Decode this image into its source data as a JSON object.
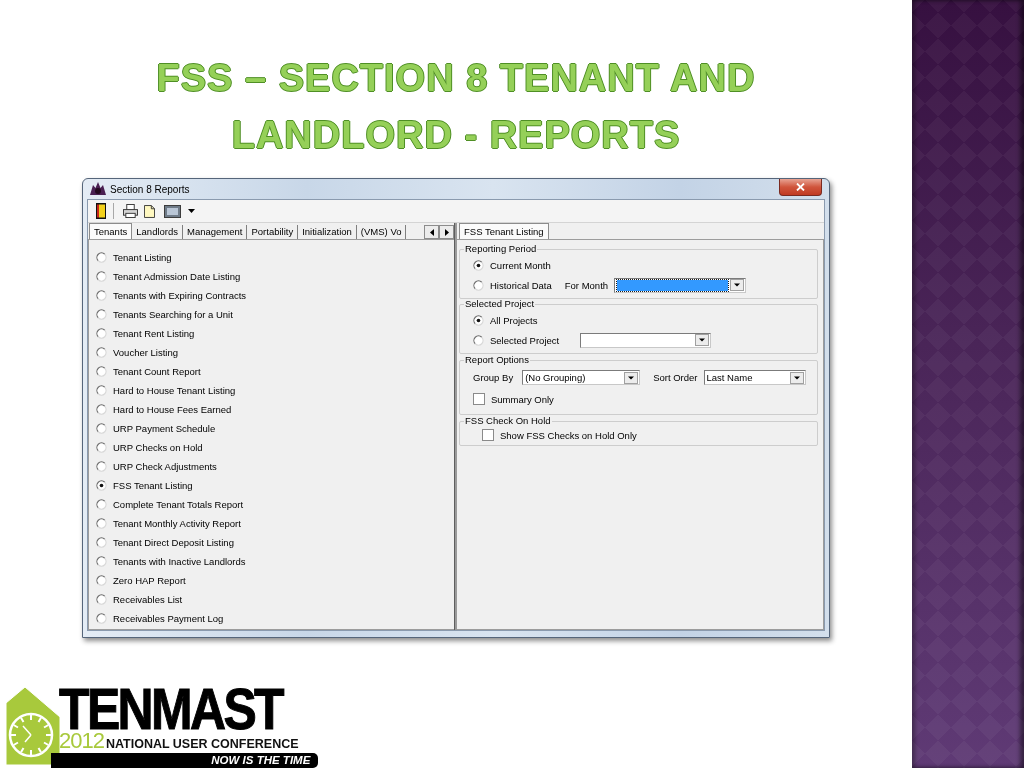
{
  "slide": {
    "title": "FSS – SECTION 8 TENANT AND LANDLORD - REPORTS"
  },
  "window": {
    "title": "Section 8 Reports"
  },
  "report_tabs": [
    {
      "label": "Tenants",
      "selected": true
    },
    {
      "label": "Landlords",
      "selected": false
    },
    {
      "label": "Management",
      "selected": false
    },
    {
      "label": "Portability",
      "selected": false
    },
    {
      "label": "Initialization",
      "selected": false
    },
    {
      "label": "(VMS) Vo",
      "selected": false
    }
  ],
  "reports": [
    {
      "label": "Tenant Listing",
      "selected": false
    },
    {
      "label": "Tenant Admission Date Listing",
      "selected": false
    },
    {
      "label": "Tenants with Expiring Contracts",
      "selected": false
    },
    {
      "label": "Tenants Searching for a Unit",
      "selected": false
    },
    {
      "label": "Tenant Rent Listing",
      "selected": false
    },
    {
      "label": "Voucher Listing",
      "selected": false
    },
    {
      "label": "Tenant Count Report",
      "selected": false
    },
    {
      "label": "Hard to House Tenant Listing",
      "selected": false
    },
    {
      "label": "Hard to House Fees Earned",
      "selected": false
    },
    {
      "label": "URP Payment Schedule",
      "selected": false
    },
    {
      "label": "URP Checks on Hold",
      "selected": false
    },
    {
      "label": "URP Check Adjustments",
      "selected": false
    },
    {
      "label": "FSS Tenant Listing",
      "selected": true
    },
    {
      "label": "Complete Tenant Totals Report",
      "selected": false
    },
    {
      "label": "Tenant Monthly Activity Report",
      "selected": false
    },
    {
      "label": "Tenant Direct Deposit Listing",
      "selected": false
    },
    {
      "label": "Tenants with Inactive Landlords",
      "selected": false
    },
    {
      "label": "Zero HAP Report",
      "selected": false
    },
    {
      "label": "Receivables List",
      "selected": false
    },
    {
      "label": "Receivables Payment Log",
      "selected": false
    }
  ],
  "options_panel": {
    "tabs": [
      {
        "label": "FSS Tenant Listing",
        "selected": true
      }
    ],
    "reporting_period": {
      "title": "Reporting Period",
      "options": [
        {
          "label": "Current Month",
          "selected": true
        },
        {
          "label": "Historical Data",
          "selected": false
        }
      ],
      "for_month": {
        "label": "For Month",
        "highlighted": true
      }
    },
    "selected_project": {
      "title": "Selected Project",
      "options": [
        {
          "label": "All Projects",
          "selected": true
        },
        {
          "label": "Selected Project",
          "selected": false
        }
      ]
    },
    "report_options": {
      "title": "Report Options",
      "group_by": {
        "label": "Group By",
        "value": "(No Grouping)"
      },
      "sort_order": {
        "label": "Sort Order",
        "value": "Last Name"
      },
      "summary_only": {
        "label": "Summary Only",
        "checked": false
      }
    },
    "fss_check_on_hold": {
      "title": "FSS Check On Hold",
      "show_only": {
        "label": "Show FSS Checks on Hold Only",
        "checked": false
      }
    }
  },
  "logo": {
    "brand": "TENMAST",
    "year": "2012",
    "event": "NATIONAL USER CONFERENCE",
    "tagline": "NOW IS THE TIME"
  }
}
